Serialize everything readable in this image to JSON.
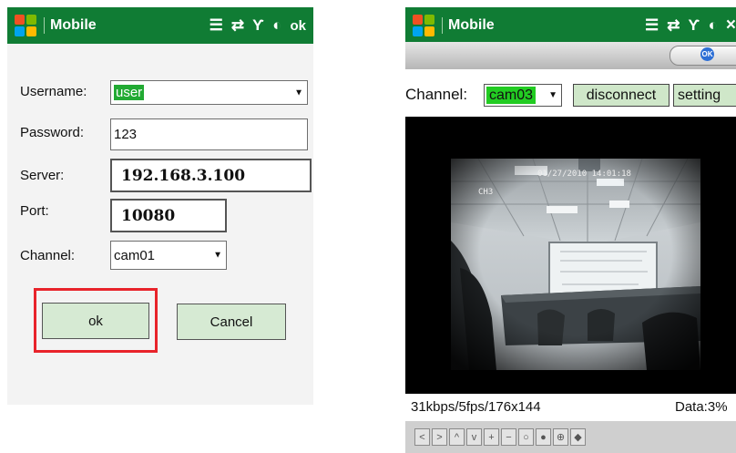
{
  "left": {
    "status_bar": {
      "title": "Mobile",
      "ok_label": "ok"
    },
    "form": {
      "username": {
        "label": "Username:",
        "value": "user"
      },
      "password": {
        "label": "Password:",
        "value": "123"
      },
      "server": {
        "label": "Server:",
        "value": "192.168.3.100"
      },
      "port": {
        "label": "Port:",
        "value": "10080"
      },
      "channel": {
        "label": "Channel:",
        "value": "cam01"
      }
    },
    "buttons": {
      "ok": "ok",
      "cancel": "Cancel"
    },
    "highlight_color": "#e8232a"
  },
  "right": {
    "status_bar": {
      "title": "Mobile",
      "close_label": "×"
    },
    "ok_badge": "OK",
    "controls": {
      "channel_label": "Channel:",
      "channel_value": "cam03",
      "disconnect_label": "disconnect",
      "setting_label": "setting"
    },
    "video": {
      "timestamp": "01/27/2010 14:01:18",
      "camera_id": "CH3"
    },
    "status": {
      "stream_info": "31kbps/5fps/176x144",
      "data_label": "Data:3%"
    },
    "toolbar": [
      "<",
      ">",
      "^",
      "v",
      "+",
      "−",
      "○",
      "●",
      "⊕",
      "◆"
    ]
  },
  "colors": {
    "titlebar_green": "#107c34",
    "button_green": "#d6ead3",
    "selection_green": "#22cc22"
  }
}
